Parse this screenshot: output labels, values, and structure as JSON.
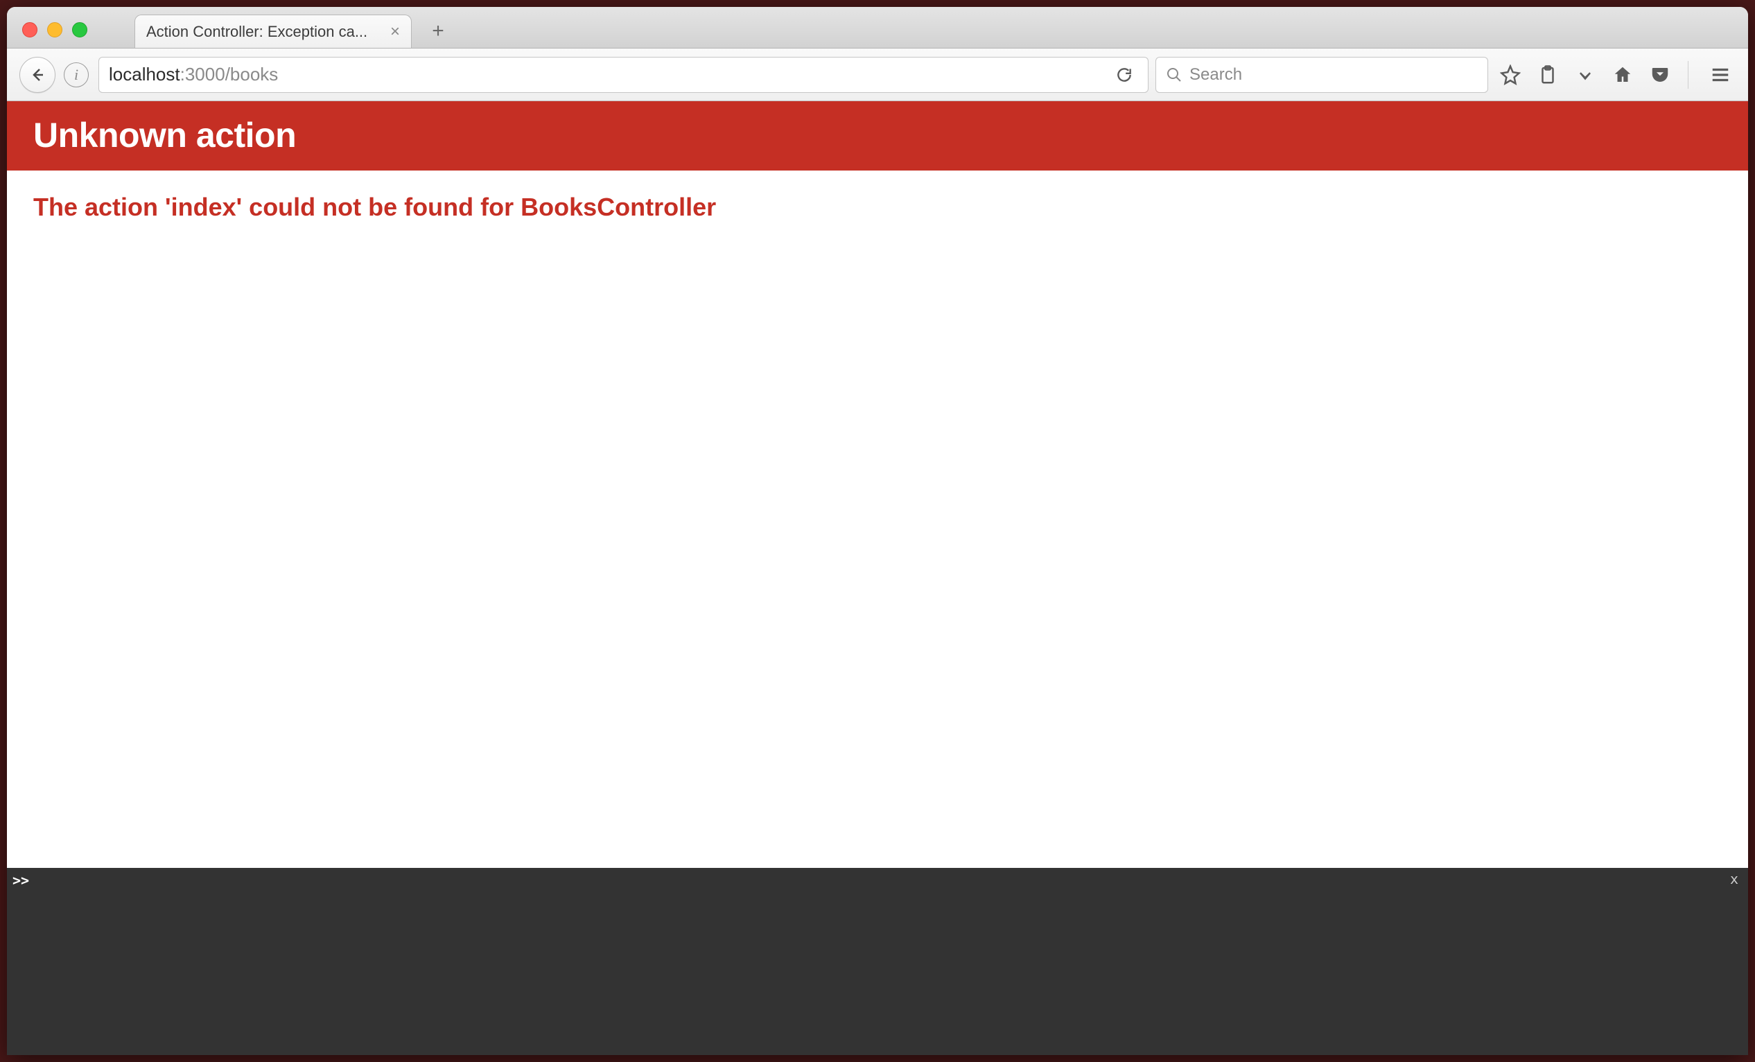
{
  "browser": {
    "tab_title": "Action Controller: Exception ca...",
    "url": {
      "host": "localhost",
      "port_and_path": ":3000/books"
    },
    "search_placeholder": "Search"
  },
  "page": {
    "title": "Unknown action",
    "message": "The action 'index' could not be found for BooksController"
  },
  "console": {
    "prompt": ">>",
    "close_label": "x"
  }
}
